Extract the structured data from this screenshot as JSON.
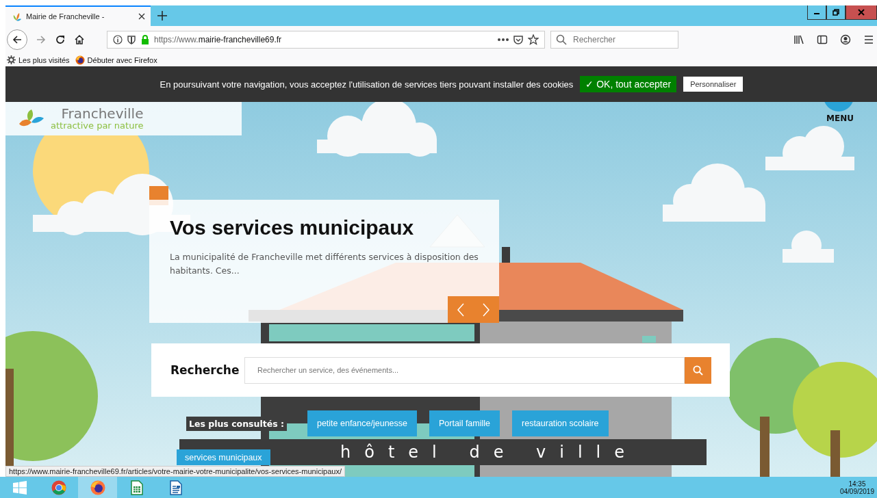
{
  "browser": {
    "tab": {
      "title": "Mairie de Francheville -",
      "selected": true
    },
    "url": {
      "scheme": "https://www.",
      "host": "mairie-francheville69.fr"
    },
    "search": {
      "placeholder": "Rechercher"
    },
    "bookmarks": [
      {
        "kind": "gear",
        "label": "Les plus visités"
      },
      {
        "kind": "firefox",
        "label": "Débuter avec Firefox"
      }
    ]
  },
  "cookie_bar": {
    "message": "En poursuivant votre navigation, vous acceptez l'utilisation de services tiers pouvant installer des cookies",
    "accept": "✓ OK, tout accepter",
    "customize": "Personnaliser"
  },
  "header": {
    "logo_name": "Francheville",
    "tagline": "attractive par nature",
    "menu": "MENU"
  },
  "slide": {
    "title": "Vos services municipaux",
    "excerpt": "La municipalité de Francheville met différents services à disposition des habitants. Ces..."
  },
  "search": {
    "label": "Recherche",
    "placeholder": "Rechercher un service, des événements..."
  },
  "quick_links": {
    "label": "Les plus consultés :",
    "items": [
      "petite enfance/jeunesse",
      "Portail famille",
      "restauration scolaire",
      "services municipaux"
    ]
  },
  "building_sign": "hôtel de ville",
  "status_url": "https://www.mairie-francheville69.fr/articles/votre-mairie-votre-municipalite/vos-services-municipaux/",
  "taskbar": {
    "apps": [
      {
        "kind": "start",
        "selected": false
      },
      {
        "kind": "chrome",
        "selected": false
      },
      {
        "kind": "firefox",
        "selected": true
      },
      {
        "kind": "calc",
        "selected": false
      },
      {
        "kind": "writer",
        "selected": false
      }
    ],
    "time": "14:35",
    "date": "04/09/2019"
  }
}
